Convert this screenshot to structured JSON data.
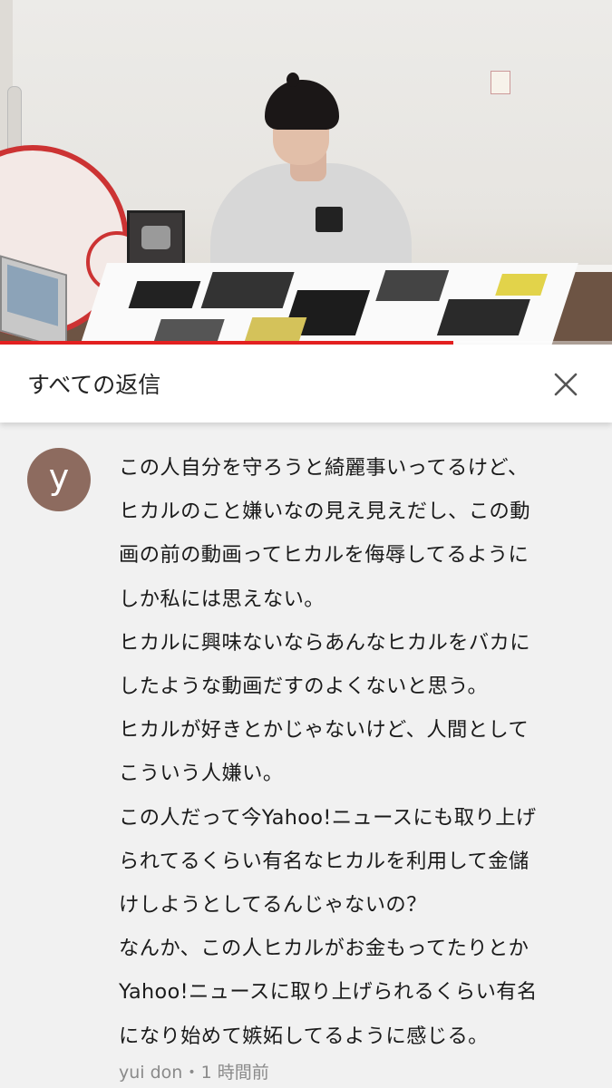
{
  "video": {
    "progress_fraction": 0.74,
    "progress_color": "#e52121"
  },
  "replies_panel": {
    "title": "すべての返信",
    "close_icon": "close-icon"
  },
  "comment": {
    "avatar_letter": "y",
    "avatar_color": "#8d6b5f",
    "lines": [
      "この人自分を守ろうと綺麗事いってるけど、",
      "ヒカルのこと嫌いなの見え見えだし、この動",
      "画の前の動画ってヒカルを侮辱してるように",
      "しか私には思えない。",
      "ヒカルに興味ないならあんなヒカルをバカに",
      "したような動画だすのよくないと思う。",
      "ヒカルが好きとかじゃないけど、人間として",
      "こういう人嫌い。",
      "この人だって今Yahoo!ニュースにも取り上げ",
      "られてるくらい有名なヒカルを利用して金儲",
      "けしようとしてるんじゃないの？",
      "なんか、この人ヒカルがお金もってたりとか",
      "Yahoo!ニュースに取り上げられるくらい有名",
      "になり始めて嫉妬してるように感じる。"
    ],
    "author": "yui don",
    "separator": "•",
    "time": "1 時間前"
  }
}
